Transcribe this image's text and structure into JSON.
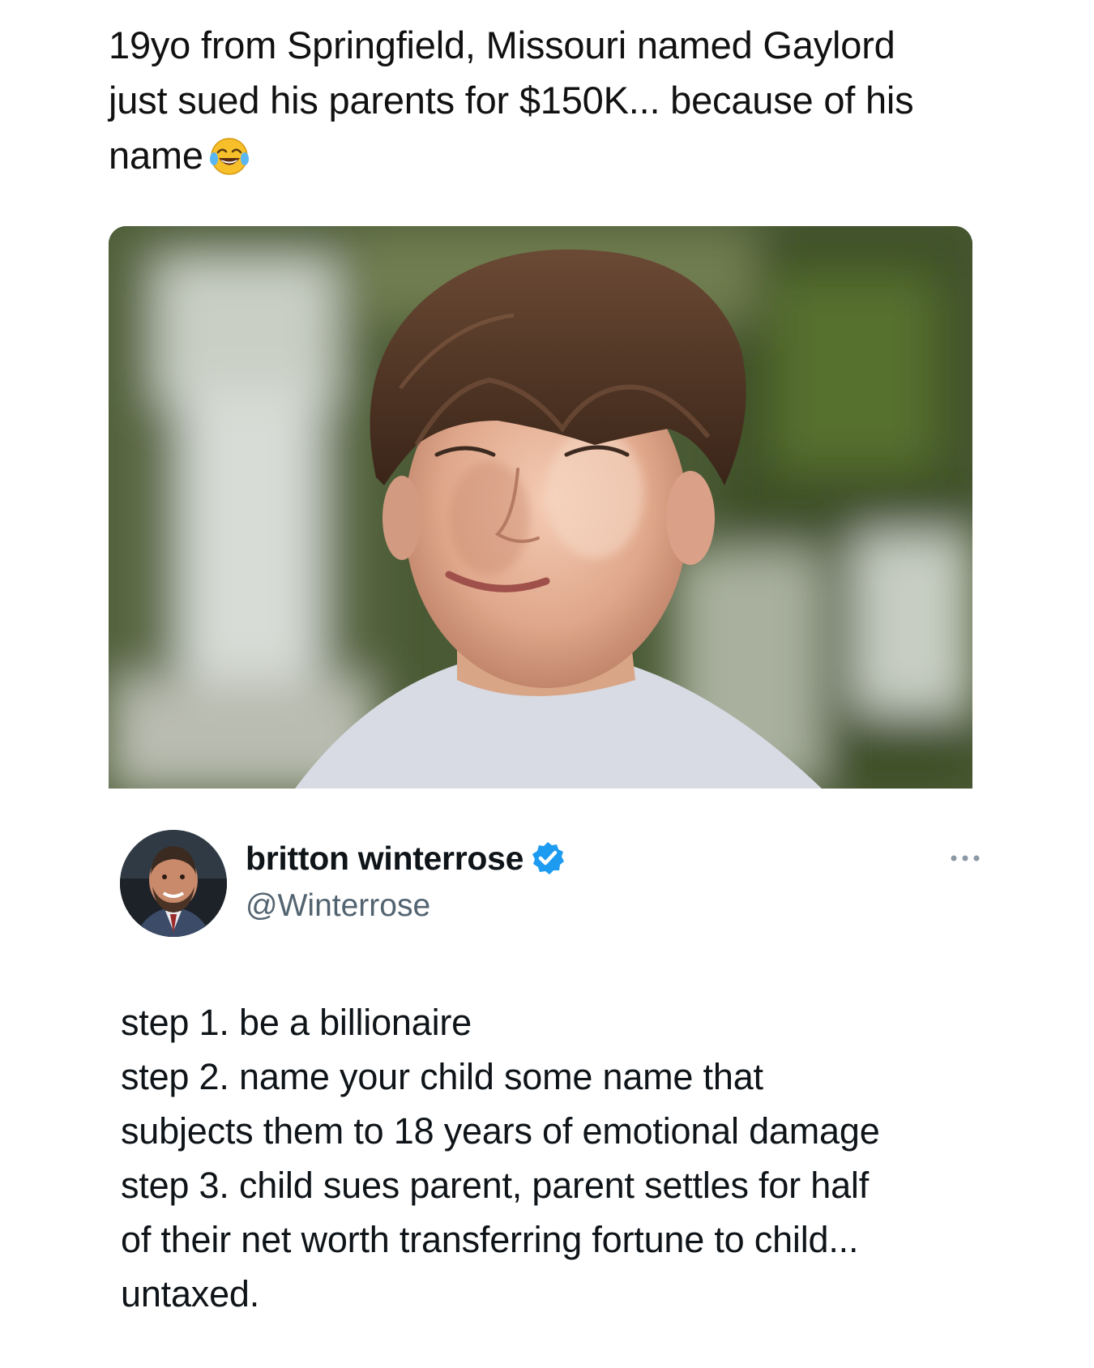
{
  "post": {
    "caption_line1": "19yo from Springfield, Missouri named Gaylord",
    "caption_line2": "just sued his parents for $150K... because of his",
    "caption_line3": "name",
    "caption_emoji": "face-with-tears-of-joy-icon"
  },
  "tweet": {
    "display_name": "britton winterrose",
    "handle": "@Winterrose",
    "verified": true,
    "verified_color": "#1d9bf0",
    "more_icon": "ellipsis-icon",
    "lines": [
      "step 1. be a billionaire",
      "step 2. name your child some name that",
      "subjects them to 18 years of emotional damage",
      "step 3. child sues parent, parent settles for half",
      "of their net worth transferring fortune to child...",
      "untaxed."
    ]
  }
}
